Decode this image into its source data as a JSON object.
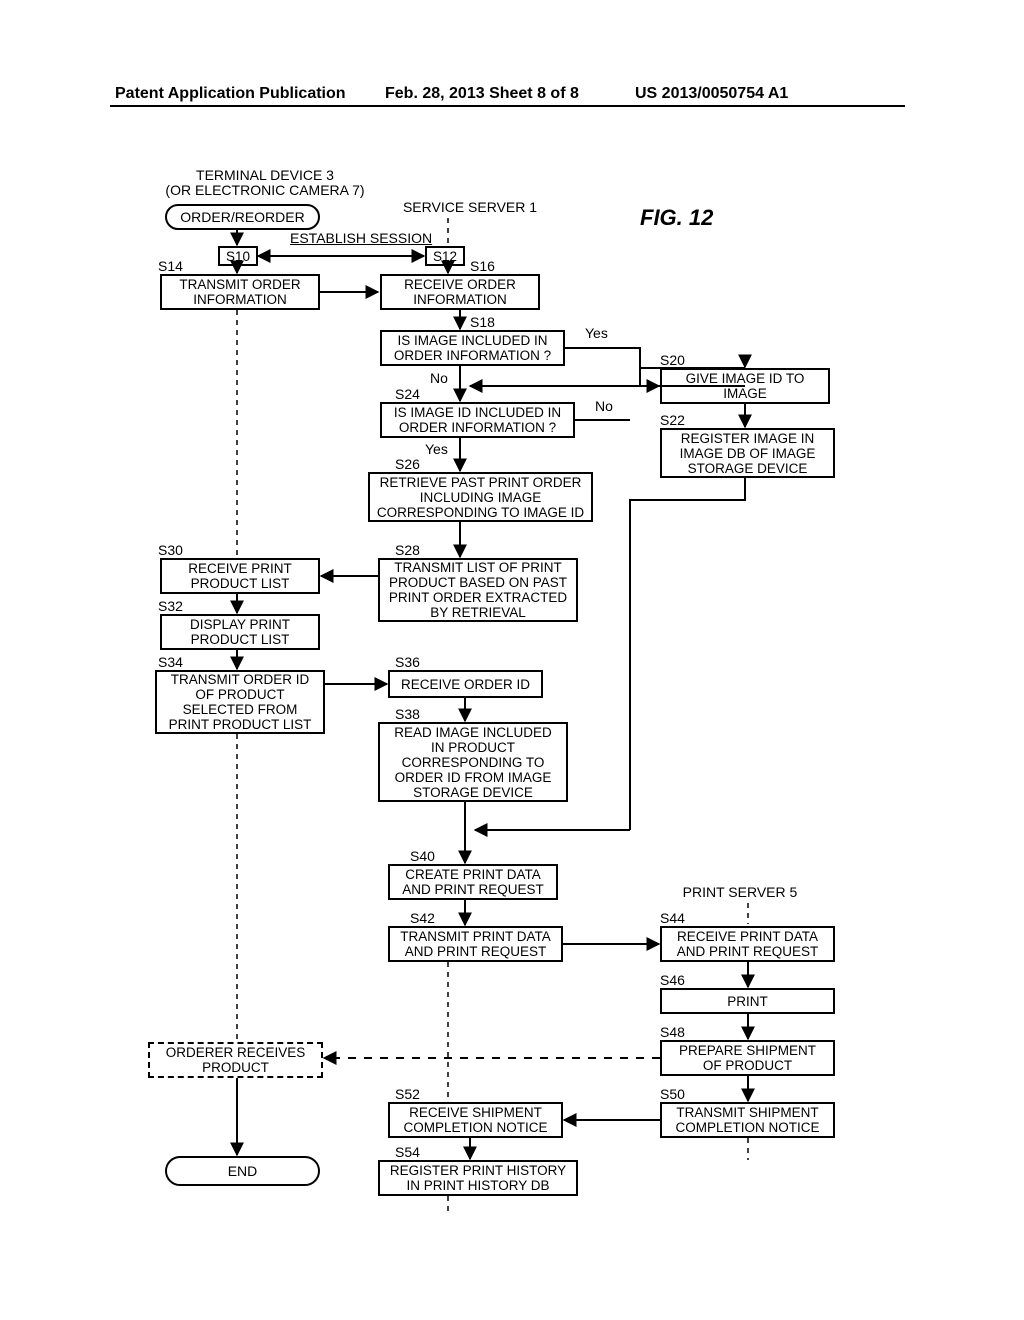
{
  "header": {
    "left": "Patent Application Publication",
    "mid": "Feb. 28, 2013  Sheet 8 of 8",
    "right": "US 2013/0050754 A1"
  },
  "fig_label": "FIG. 12",
  "lanes": {
    "terminal": "TERMINAL DEVICE 3\n(OR ELECTRONIC CAMERA 7)",
    "service": "SERVICE SERVER 1",
    "printsrv": "PRINT SERVER 5"
  },
  "start": "ORDER/REORDER",
  "establish": "ESTABLISH SESSION",
  "s10": "S10",
  "s12": "S12",
  "s14_lbl": "S14",
  "s14": "TRANSMIT ORDER\nINFORMATION",
  "s16_lbl": "S16",
  "s16": "RECEIVE ORDER\nINFORMATION",
  "s18_lbl": "S18",
  "s18": "IS IMAGE INCLUDED IN\nORDER INFORMATION ?",
  "yes": "Yes",
  "no": "No",
  "s20_lbl": "S20",
  "s20": "GIVE IMAGE ID TO\nIMAGE",
  "s22_lbl": "S22",
  "s22": "REGISTER IMAGE IN\nIMAGE DB OF IMAGE\nSTORAGE DEVICE",
  "s24_lbl": "S24",
  "s24": "IS IMAGE ID INCLUDED IN\nORDER INFORMATION ?",
  "s26_lbl": "S26",
  "s26": "RETRIEVE PAST PRINT ORDER\nINCLUDING IMAGE\nCORRESPONDING TO IMAGE ID",
  "s28_lbl": "S28",
  "s28": "TRANSMIT LIST OF PRINT\nPRODUCT BASED ON PAST\nPRINT ORDER EXTRACTED\nBY RETRIEVAL",
  "s30_lbl": "S30",
  "s30": "RECEIVE PRINT\nPRODUCT LIST",
  "s32_lbl": "S32",
  "s32": "DISPLAY PRINT\nPRODUCT LIST",
  "s34_lbl": "S34",
  "s34": "TRANSMIT ORDER ID\nOF PRODUCT\nSELECTED FROM\nPRINT PRODUCT LIST",
  "s36_lbl": "S36",
  "s36": "RECEIVE ORDER ID",
  "s38_lbl": "S38",
  "s38": "READ IMAGE INCLUDED\nIN PRODUCT\nCORRESPONDING TO\nORDER ID FROM IMAGE\nSTORAGE DEVICE",
  "s40_lbl": "S40",
  "s40": "CREATE PRINT DATA\nAND PRINT REQUEST",
  "s42_lbl": "S42",
  "s42": "TRANSMIT PRINT DATA\nAND PRINT REQUEST",
  "s44_lbl": "S44",
  "s44": "RECEIVE PRINT DATA\nAND PRINT REQUEST",
  "s46_lbl": "S46",
  "s46": "PRINT",
  "s48_lbl": "S48",
  "s48": "PREPARE SHIPMENT\nOF PRODUCT",
  "orderer": "ORDERER RECEIVES\nPRODUCT",
  "s50_lbl": "S50",
  "s50": "TRANSMIT SHIPMENT\nCOMPLETION NOTICE",
  "s52_lbl": "S52",
  "s52": "RECEIVE SHIPMENT\nCOMPLETION NOTICE",
  "s54_lbl": "S54",
  "s54": "REGISTER PRINT HISTORY\nIN PRINT HISTORY DB",
  "end": "END",
  "chart_data": {
    "type": "table",
    "note": "Flowchart sequence diagram with three swimlanes",
    "lanes": [
      "TERMINAL DEVICE 3 (OR ELECTRONIC CAMERA 7)",
      "SERVICE SERVER 1",
      "PRINT SERVER 5"
    ],
    "steps": [
      {
        "id": "start",
        "lane": 0,
        "label": "ORDER/REORDER",
        "shape": "terminator"
      },
      {
        "id": "S10",
        "lane": 0,
        "to_lane": 1,
        "label": "ESTABLISH SESSION"
      },
      {
        "id": "S12",
        "lane": 1
      },
      {
        "id": "S14",
        "lane": 0,
        "label": "TRANSMIT ORDER INFORMATION"
      },
      {
        "id": "S16",
        "lane": 1,
        "label": "RECEIVE ORDER INFORMATION"
      },
      {
        "id": "S18",
        "lane": 1,
        "label": "IS IMAGE INCLUDED IN ORDER INFORMATION ?",
        "decision": true,
        "yes": "S20",
        "no": "S24"
      },
      {
        "id": "S20",
        "lane": 2,
        "label": "GIVE IMAGE ID TO IMAGE"
      },
      {
        "id": "S22",
        "lane": 2,
        "label": "REGISTER IMAGE IN IMAGE DB OF IMAGE STORAGE DEVICE"
      },
      {
        "id": "S24",
        "lane": 1,
        "label": "IS IMAGE ID INCLUDED IN ORDER INFORMATION ?",
        "decision": true,
        "yes": "S26",
        "no": "S40"
      },
      {
        "id": "S26",
        "lane": 1,
        "label": "RETRIEVE PAST PRINT ORDER INCLUDING IMAGE CORRESPONDING TO IMAGE ID"
      },
      {
        "id": "S28",
        "lane": 1,
        "label": "TRANSMIT LIST OF PRINT PRODUCT BASED ON PAST PRINT ORDER EXTRACTED BY RETRIEVAL"
      },
      {
        "id": "S30",
        "lane": 0,
        "label": "RECEIVE PRINT PRODUCT LIST"
      },
      {
        "id": "S32",
        "lane": 0,
        "label": "DISPLAY PRINT PRODUCT LIST"
      },
      {
        "id": "S34",
        "lane": 0,
        "label": "TRANSMIT ORDER ID OF PRODUCT SELECTED FROM PRINT PRODUCT LIST"
      },
      {
        "id": "S36",
        "lane": 1,
        "label": "RECEIVE ORDER ID"
      },
      {
        "id": "S38",
        "lane": 1,
        "label": "READ IMAGE INCLUDED IN PRODUCT CORRESPONDING TO ORDER ID FROM IMAGE STORAGE DEVICE"
      },
      {
        "id": "S40",
        "lane": 1,
        "label": "CREATE PRINT DATA AND PRINT REQUEST"
      },
      {
        "id": "S42",
        "lane": 1,
        "label": "TRANSMIT PRINT DATA AND PRINT REQUEST"
      },
      {
        "id": "S44",
        "lane": 2,
        "label": "RECEIVE PRINT DATA AND PRINT REQUEST"
      },
      {
        "id": "S46",
        "lane": 2,
        "label": "PRINT"
      },
      {
        "id": "S48",
        "lane": 2,
        "label": "PREPARE SHIPMENT OF PRODUCT"
      },
      {
        "id": "orderer",
        "lane": 0,
        "label": "ORDERER RECEIVES PRODUCT",
        "shape": "dashed"
      },
      {
        "id": "S50",
        "lane": 2,
        "label": "TRANSMIT SHIPMENT COMPLETION NOTICE"
      },
      {
        "id": "S52",
        "lane": 1,
        "label": "RECEIVE SHIPMENT COMPLETION NOTICE"
      },
      {
        "id": "S54",
        "lane": 1,
        "label": "REGISTER PRINT HISTORY IN PRINT HISTORY DB"
      },
      {
        "id": "end",
        "lane": 0,
        "label": "END",
        "shape": "terminator"
      }
    ]
  }
}
